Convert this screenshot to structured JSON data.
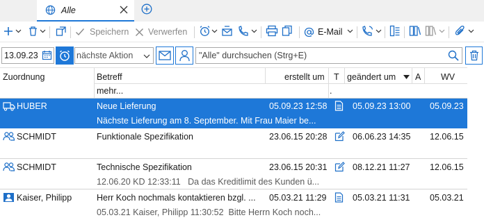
{
  "tab": {
    "title": "Alle"
  },
  "toolbar": {
    "save_label": "Speichern",
    "discard_label": "Verwerfen",
    "email_label": "E-Mail"
  },
  "filter": {
    "date": "13.09.23",
    "action_select": "nächste Aktion",
    "search_placeholder": "\"Alle\" durchsuchen (Strg+E)"
  },
  "columns": {
    "zuordnung": "Zuordnung",
    "betreff": "Betreff",
    "mehr": "mehr...",
    "erstellt": "erstellt um",
    "t": "T",
    "geaendert": "geändert um",
    "a": "A",
    "wv": "WV",
    "dot": "."
  },
  "rows": [
    {
      "zuordnung": "HUBER",
      "betreff": "Neue Lieferung",
      "erstellt": "05.09.23 12:58",
      "geaendert": "05.09.23 13:00",
      "wv": "05.09.23",
      "detail": "Nächste Lieferung am 8. September. Mit Frau Maier be...",
      "icon": "truck-icon",
      "type_icon": "document-icon",
      "selected": true
    },
    {
      "zuordnung": "SCHMIDT",
      "betreff": "Funktionale Spezifikation",
      "erstellt": "23.06.15 20:28",
      "geaendert": "06.06.23 14:35",
      "wv": "12.06.15",
      "detail": "",
      "icon": "group-icon",
      "type_icon": "edit-icon",
      "selected": false
    },
    {
      "zuordnung": "SCHMIDT",
      "betreff": "Technische Spezifikation",
      "erstellt": "23.06.15 20:31",
      "geaendert": "08.12.21 11:27",
      "wv": "12.06.15",
      "detail": "12.06.20 KD 12:33:11   Da das Kreditlimit des Kunden ü...",
      "icon": "group-icon",
      "type_icon": "edit-icon",
      "selected": false
    },
    {
      "zuordnung": "Kaiser, Philipp",
      "betreff": "Herr Koch nochmals kontaktieren bzgl. ...",
      "erstellt": "05.03.21 11:29",
      "geaendert": "05.03.21 11:31",
      "wv": "05.03.21",
      "detail": "05.03.21 Kaiser, Philipp 11:30:52  Bitte Herrn Koch noch...",
      "icon": "contact-icon",
      "type_icon": "document-icon",
      "selected": false
    }
  ],
  "colors": {
    "accent": "#1e78d8",
    "icon_blue": "#1e6fc8"
  }
}
